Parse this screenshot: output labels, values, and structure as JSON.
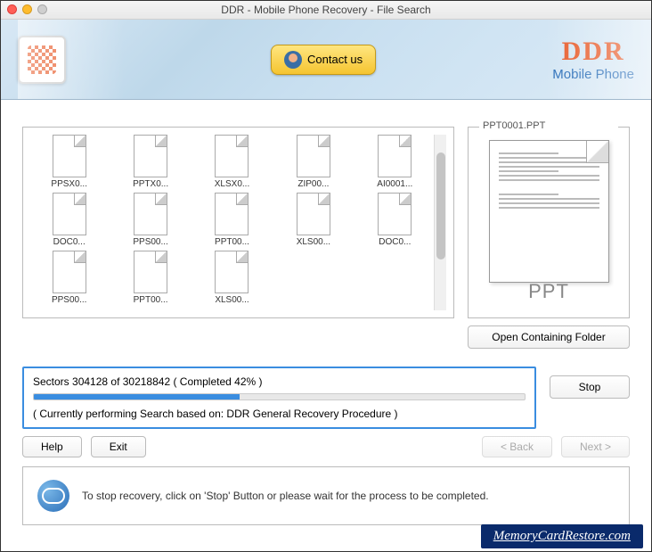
{
  "window": {
    "title": "DDR - Mobile Phone Recovery - File Search"
  },
  "header": {
    "contact_label": "Contact us",
    "brand": "DDR",
    "brand_sub": "Mobile Phone"
  },
  "files": {
    "items": [
      {
        "name": "PPSX0..."
      },
      {
        "name": "PPTX0..."
      },
      {
        "name": "XLSX0..."
      },
      {
        "name": "ZIP00..."
      },
      {
        "name": "AI0001..."
      },
      {
        "name": "DOC0..."
      },
      {
        "name": "PPS00..."
      },
      {
        "name": "PPT00..."
      },
      {
        "name": "XLS00..."
      },
      {
        "name": "DOC0..."
      },
      {
        "name": "PPS00..."
      },
      {
        "name": "PPT00..."
      },
      {
        "name": "XLS00..."
      }
    ]
  },
  "preview": {
    "filename": "PPT0001.PPT",
    "type_label": "PPT",
    "open_folder_label": "Open Containing Folder"
  },
  "progress": {
    "text": "Sectors 304128 of 30218842   ( Completed  42% )",
    "percent": 42,
    "note": "( Currently performing Search based on: DDR General Recovery Procedure )",
    "stop_label": "Stop"
  },
  "nav": {
    "help": "Help",
    "exit": "Exit",
    "back": "< Back",
    "next": "Next >"
  },
  "tip": {
    "text": "To stop recovery, click on 'Stop' Button or please wait for the process to be completed."
  },
  "footer": {
    "link": "MemoryCardRestore.com"
  }
}
